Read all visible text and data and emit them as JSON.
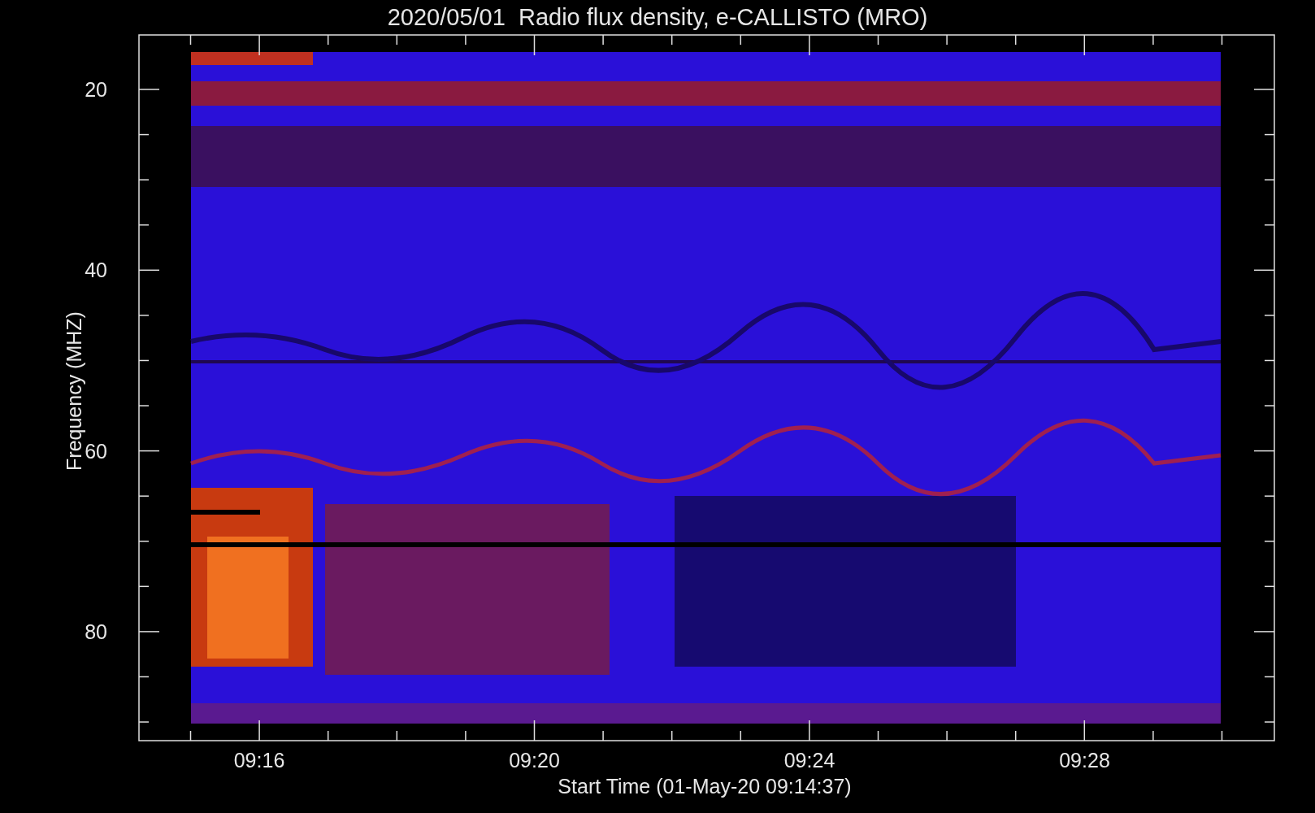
{
  "title": "2020/05/01  Radio flux density, e-CALLISTO (MRO)",
  "y_axis": {
    "label": "Frequency (MHZ)",
    "ticks": [
      "20",
      "40",
      "60",
      "80"
    ]
  },
  "x_axis": {
    "label": "Start Time (01-May-20 09:14:37)",
    "ticks": [
      "09:16",
      "09:20",
      "09:24",
      "09:28"
    ]
  }
}
